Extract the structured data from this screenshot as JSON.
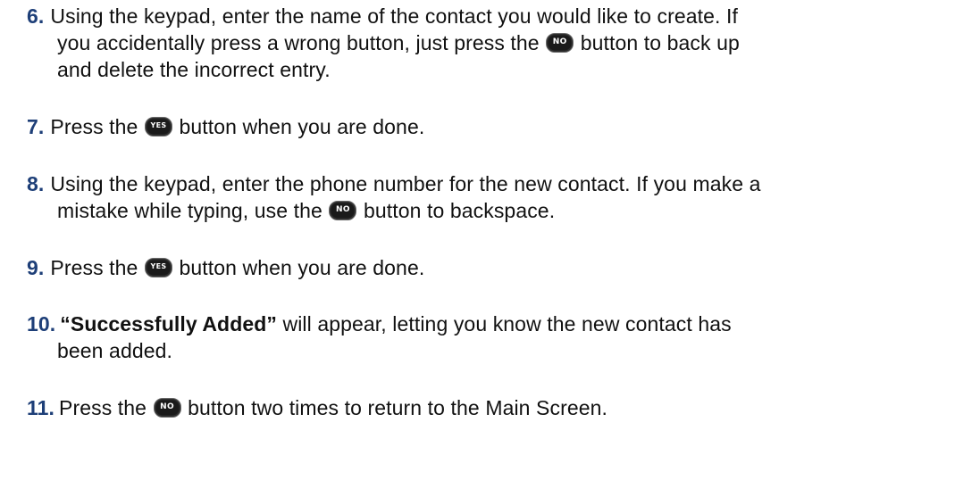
{
  "buttons": {
    "no": "NO",
    "yes": "YES"
  },
  "steps": [
    {
      "number": "6.",
      "line1_a": "Using the keypad, enter the name of the contact you would like to create. If",
      "line2_a": "you accidentally press a wrong button, just press the",
      "line2_b": "button to back up",
      "line3": "and delete the incorrect entry."
    },
    {
      "number": "7.",
      "text_a": "Press the",
      "text_b": "button when you are done."
    },
    {
      "number": "8.",
      "line1": "Using the keypad, enter the phone number for the new contact. If you make a",
      "line2_a": "mistake while typing, use the",
      "line2_b": "button to backspace."
    },
    {
      "number": "9.",
      "text_a": "Press the",
      "text_b": "button when you are done."
    },
    {
      "number": "10.",
      "bold": "“Successfully Added”",
      "line1_b": "will appear, letting you know the new contact has",
      "line2": "been added."
    },
    {
      "number": "11.",
      "text_a": "Press the",
      "text_b": "button two times to return to the Main Screen."
    }
  ]
}
